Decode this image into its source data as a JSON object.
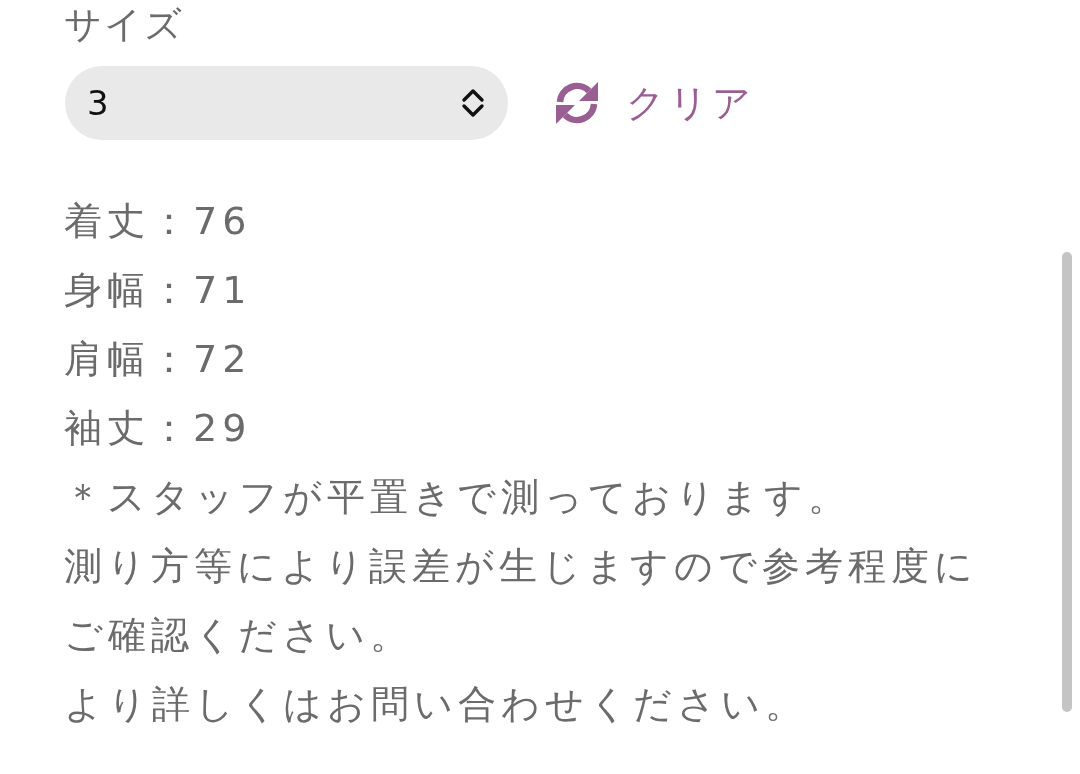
{
  "size_field": {
    "label": "サイズ",
    "value": "3",
    "clear_label": "クリア"
  },
  "specs": [
    "着丈：76",
    "身幅：71",
    "肩幅：72",
    "袖丈：29"
  ],
  "notes": [
    "＊スタッフが平置きで測っております。",
    "測り方等により誤差が生じますので参考程度にご確認ください。",
    "より詳しくはお問い合わせください。"
  ]
}
